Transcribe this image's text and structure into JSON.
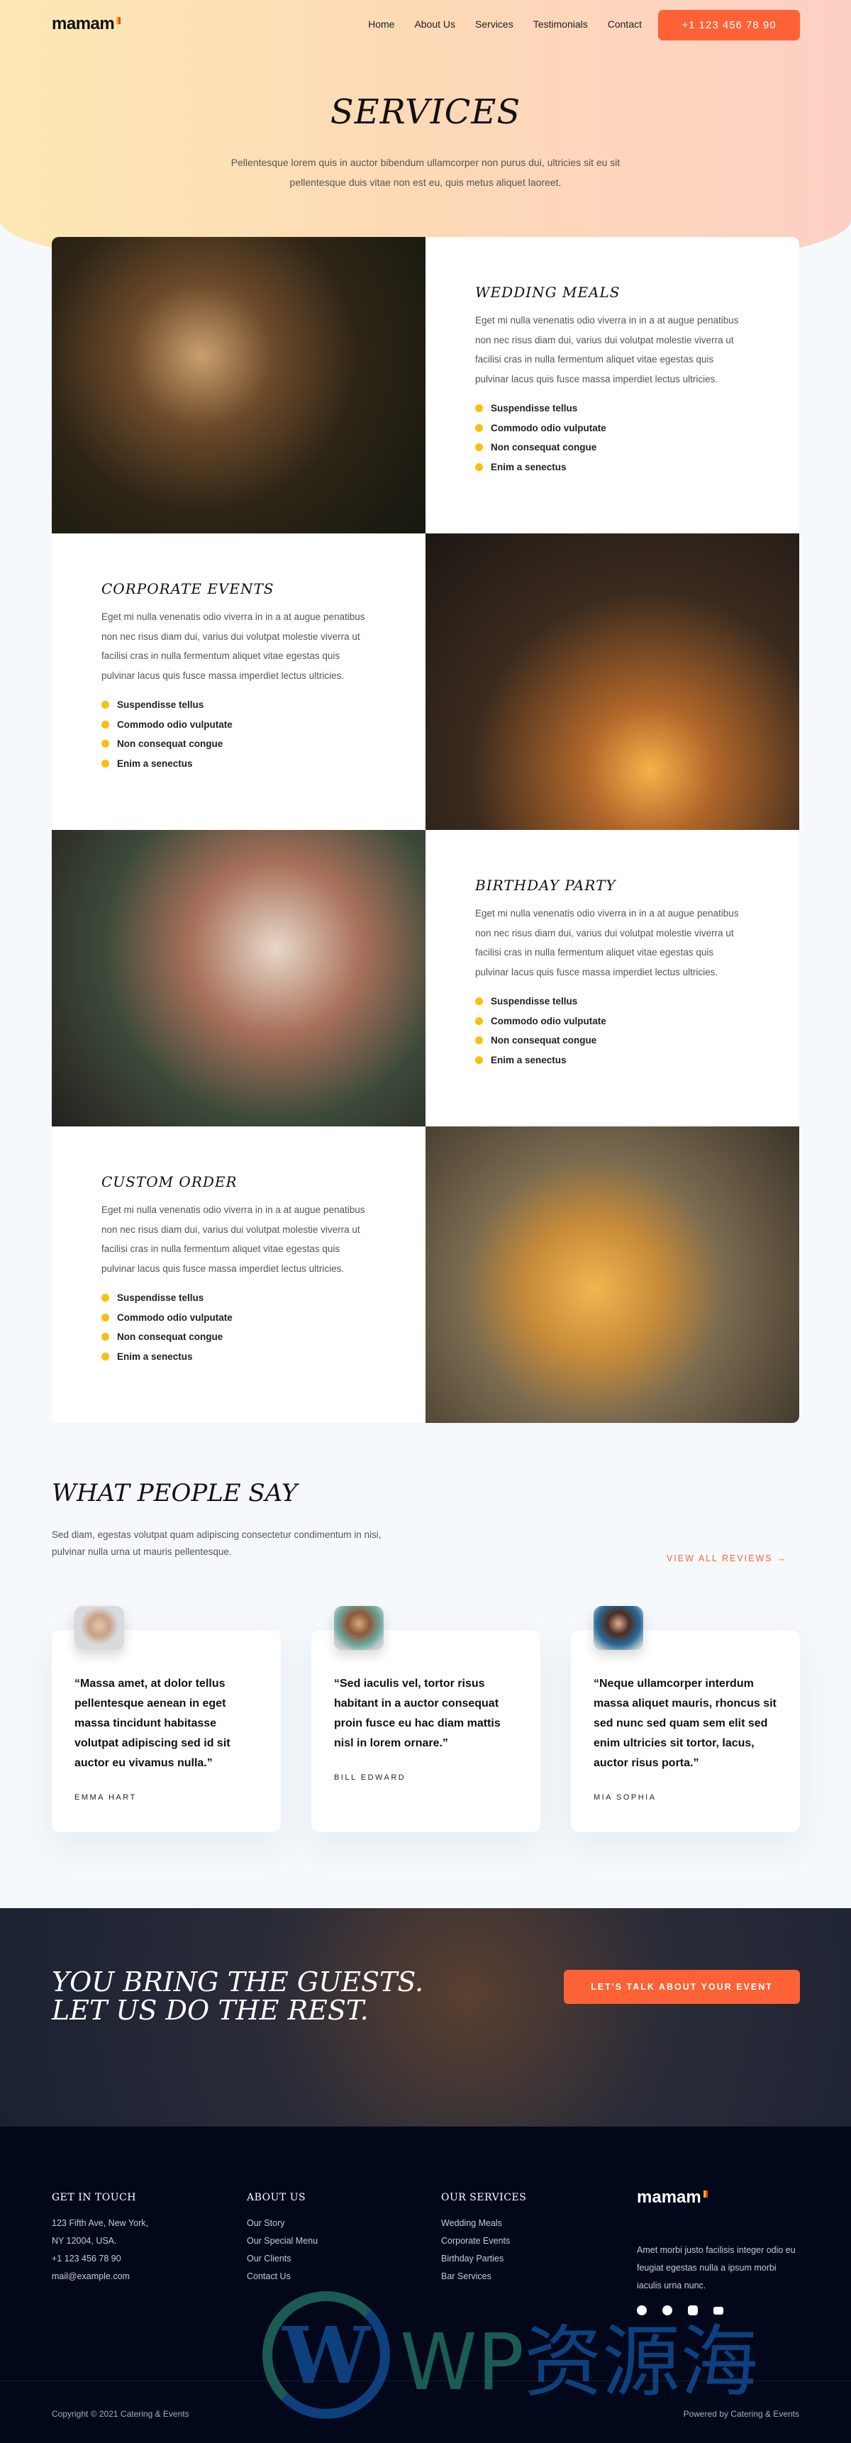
{
  "brand": {
    "name": "mamam",
    "accent": "#fd6237",
    "bullet_color": "#fcbf0d"
  },
  "nav": {
    "items": [
      "Home",
      "About Us",
      "Services",
      "Testimonials",
      "Contact"
    ],
    "phone": "+1 123 456 78 90"
  },
  "hero": {
    "title": "SERVICES",
    "subtitle": "Pellentesque lorem quis in auctor bibendum ullamcorper non purus dui, ultricies sit eu sit pellentesque duis vitae non est eu, quis metus aliquet laoreet."
  },
  "services": [
    {
      "title": "WEDDING MEALS",
      "text": "Eget mi nulla venenatis odio viverra in in a at augue penatibus non nec risus diam dui, varius dui volutpat molestie viverra ut facilisi cras in nulla fermentum aliquet vitae egestas quis pulvinar lacus quis fusce massa imperdiet lectus ultricies.",
      "bullets": [
        "Suspendisse tellus",
        "Commodo odio vulputate",
        "Non consequat congue",
        "Enim a senectus"
      ]
    },
    {
      "title": "CORPORATE EVENTS",
      "text": "Eget mi nulla venenatis odio viverra in in a at augue penatibus non nec risus diam dui, varius dui volutpat molestie viverra ut facilisi cras in nulla fermentum aliquet vitae egestas quis pulvinar lacus quis fusce massa imperdiet lectus ultricies.",
      "bullets": [
        "Suspendisse tellus",
        "Commodo odio vulputate",
        "Non consequat congue",
        "Enim a senectus"
      ]
    },
    {
      "title": "BIRTHDAY PARTY",
      "text": "Eget mi nulla venenatis odio viverra in in a at augue penatibus non nec risus diam dui, varius dui volutpat molestie viverra ut facilisi cras in nulla fermentum aliquet vitae egestas quis pulvinar lacus quis fusce massa imperdiet lectus ultricies.",
      "bullets": [
        "Suspendisse tellus",
        "Commodo odio vulputate",
        "Non consequat congue",
        "Enim a senectus"
      ]
    },
    {
      "title": "CUSTOM ORDER",
      "text": "Eget mi nulla venenatis odio viverra in in a at augue penatibus non nec risus diam dui, varius dui volutpat molestie viverra ut facilisi cras in nulla fermentum aliquet vitae egestas quis pulvinar lacus quis fusce massa imperdiet lectus ultricies.",
      "bullets": [
        "Suspendisse tellus",
        "Commodo odio vulputate",
        "Non consequat congue",
        "Enim a senectus"
      ]
    }
  ],
  "testimonials": {
    "title": "WHAT PEOPLE SAY",
    "subtitle": "Sed diam, egestas volutpat quam adipiscing consectetur condimentum in nisi, pulvinar nulla urna ut mauris pellentesque.",
    "view_all": "VIEW ALL REVIEWS →",
    "items": [
      {
        "quote": "“Massa amet, at dolor tellus pellentesque aenean in eget massa tincidunt habitasse volutpat adipiscing sed id sit auctor eu vivamus nulla.”",
        "name": "EMMA HART"
      },
      {
        "quote": "“Sed iaculis vel, tortor risus habitant in a auctor consequat proin fusce eu hac diam mattis nisl in lorem ornare.”",
        "name": "BILL EDWARD"
      },
      {
        "quote": "“Neque ullamcorper interdum massa aliquet mauris, rhoncus sit sed nunc sed quam sem elit sed enim ultricies sit tortor, lacus, auctor risus porta.”",
        "name": "MIA SOPHIA"
      }
    ]
  },
  "cta": {
    "line1": "YOU BRING THE GUESTS.",
    "line2": "LET US DO THE REST.",
    "button": "LET'S TALK ABOUT YOUR EVENT"
  },
  "footer": {
    "contact": {
      "title": "GET IN TOUCH",
      "lines": [
        "123 Fifth Ave, New York,",
        "NY 12004, USA.",
        "+1 123 456 78 90",
        "mail@example.com"
      ]
    },
    "about": {
      "title": "ABOUT US",
      "links": [
        "Our Story",
        "Our Special Menu",
        "Our Clients",
        "Contact Us"
      ]
    },
    "services": {
      "title": "OUR SERVICES",
      "links": [
        "Wedding Meals",
        "Corporate Events",
        "Birthday Parties",
        "Bar Services"
      ]
    },
    "description": "Amet morbi justo facilisis integer odio eu feugiat egestas nulla a ipsum morbi iaculis urna nunc.",
    "social": [
      "facebook-icon",
      "twitter-icon",
      "instagram-icon",
      "youtube-icon"
    ],
    "copyright": "Copyright © 2021 Catering & Events",
    "powered": "Powered by Catering & Events"
  },
  "watermark": {
    "text": "WP资源海"
  }
}
